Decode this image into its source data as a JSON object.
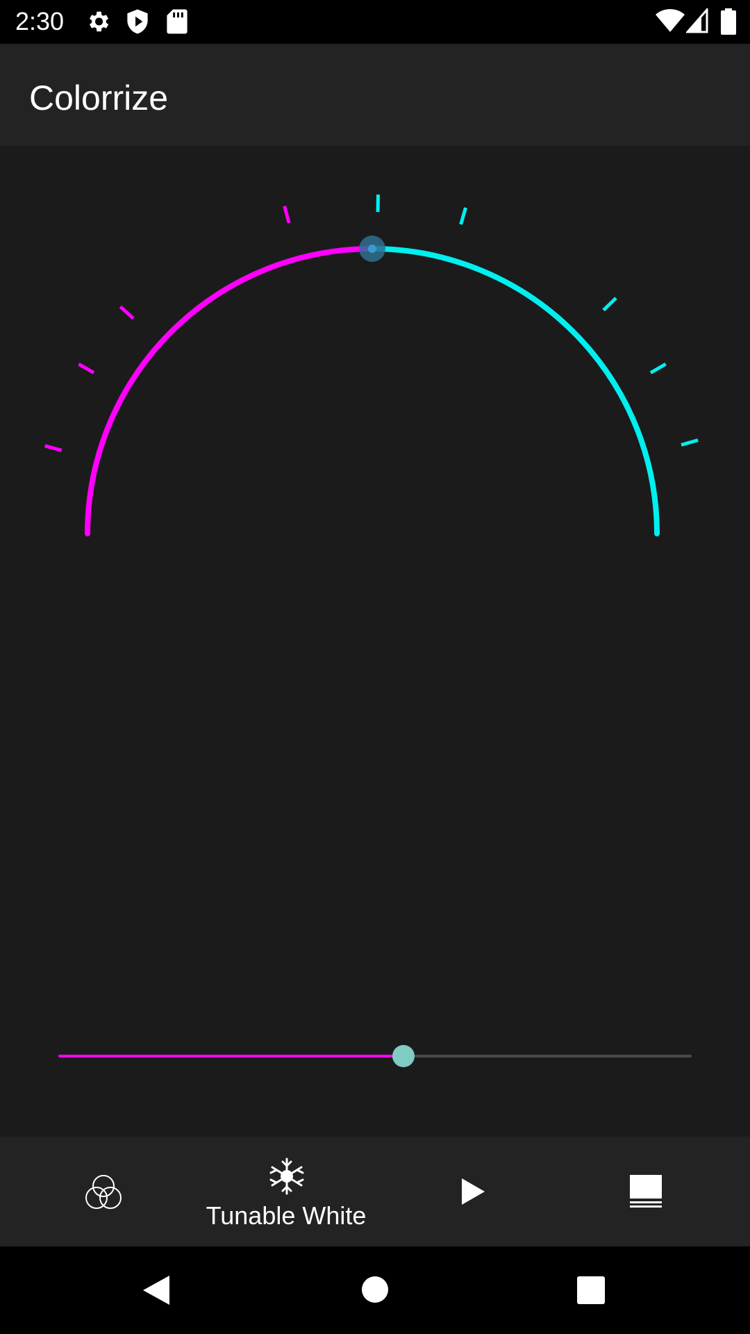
{
  "status_bar": {
    "time": "2:30",
    "icons_left": [
      "gear-icon",
      "shield-icon",
      "sd-card-icon"
    ],
    "icons_right": [
      "wifi-icon",
      "signal-icon",
      "battery-icon"
    ]
  },
  "app_bar": {
    "title": "Colorrize"
  },
  "dial": {
    "warm_color": "#ff00ff",
    "cool_color": "#00f0f0",
    "handle_color": "#2f6f8f",
    "value_fraction": 0.5
  },
  "slider": {
    "value_fraction": 0.545,
    "fill_color": "#ff00ff",
    "track_color": "#4a4a4a",
    "thumb_color": "#80cbc4"
  },
  "bottom_nav": {
    "items": [
      {
        "icon": "color-circles-icon",
        "label": ""
      },
      {
        "icon": "snowflake-sun-icon",
        "label": "Tunable White",
        "active": true
      },
      {
        "icon": "play-icon",
        "label": ""
      },
      {
        "icon": "panel-icon",
        "label": ""
      }
    ]
  },
  "system_nav": {
    "buttons": [
      "back-icon",
      "home-icon",
      "recents-icon"
    ]
  }
}
